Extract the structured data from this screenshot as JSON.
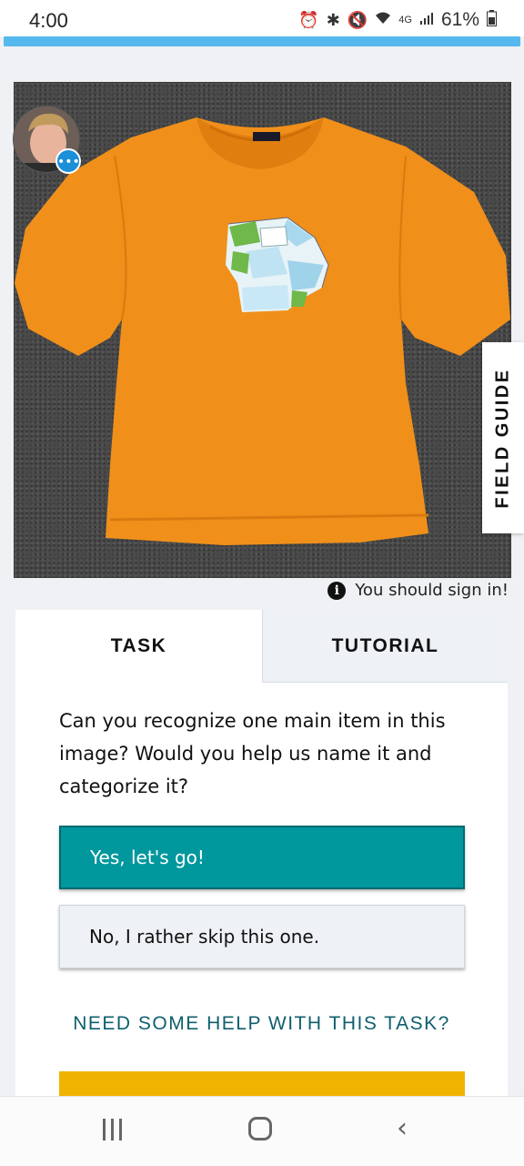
{
  "status_bar": {
    "time": "4:00",
    "battery_percent": "61%",
    "network": "4G",
    "icons": [
      "alarm-icon",
      "bluetooth-icon",
      "vibrate-mute-icon",
      "wifi-icon",
      "signal-icon",
      "battery-icon"
    ]
  },
  "progress": {
    "fraction": 1.0,
    "color": "#56b8ec"
  },
  "subject": {
    "image_icon": "orange-tshirt-photo",
    "field_guide_label": "FIELD GUIDE"
  },
  "sign_in_notice": "You should sign in!",
  "tabs": [
    {
      "label": "TASK",
      "active": true
    },
    {
      "label": "TUTORIAL",
      "active": false
    }
  ],
  "task": {
    "question": "Can you recognize one main item in this image? Would you help us name it and categorize it?",
    "yes_label": "Yes, let's go!",
    "no_label": "No, I rather skip this one.",
    "help_link": "NEED SOME HELP WITH THIS TASK?"
  },
  "colors": {
    "primary_button": "#00979d",
    "link": "#0f5f6e",
    "accent_bar": "#f0b400",
    "shirt": "#f0901a"
  },
  "nav_bar": {
    "icons": [
      "recents-icon",
      "home-icon",
      "back-icon"
    ]
  }
}
